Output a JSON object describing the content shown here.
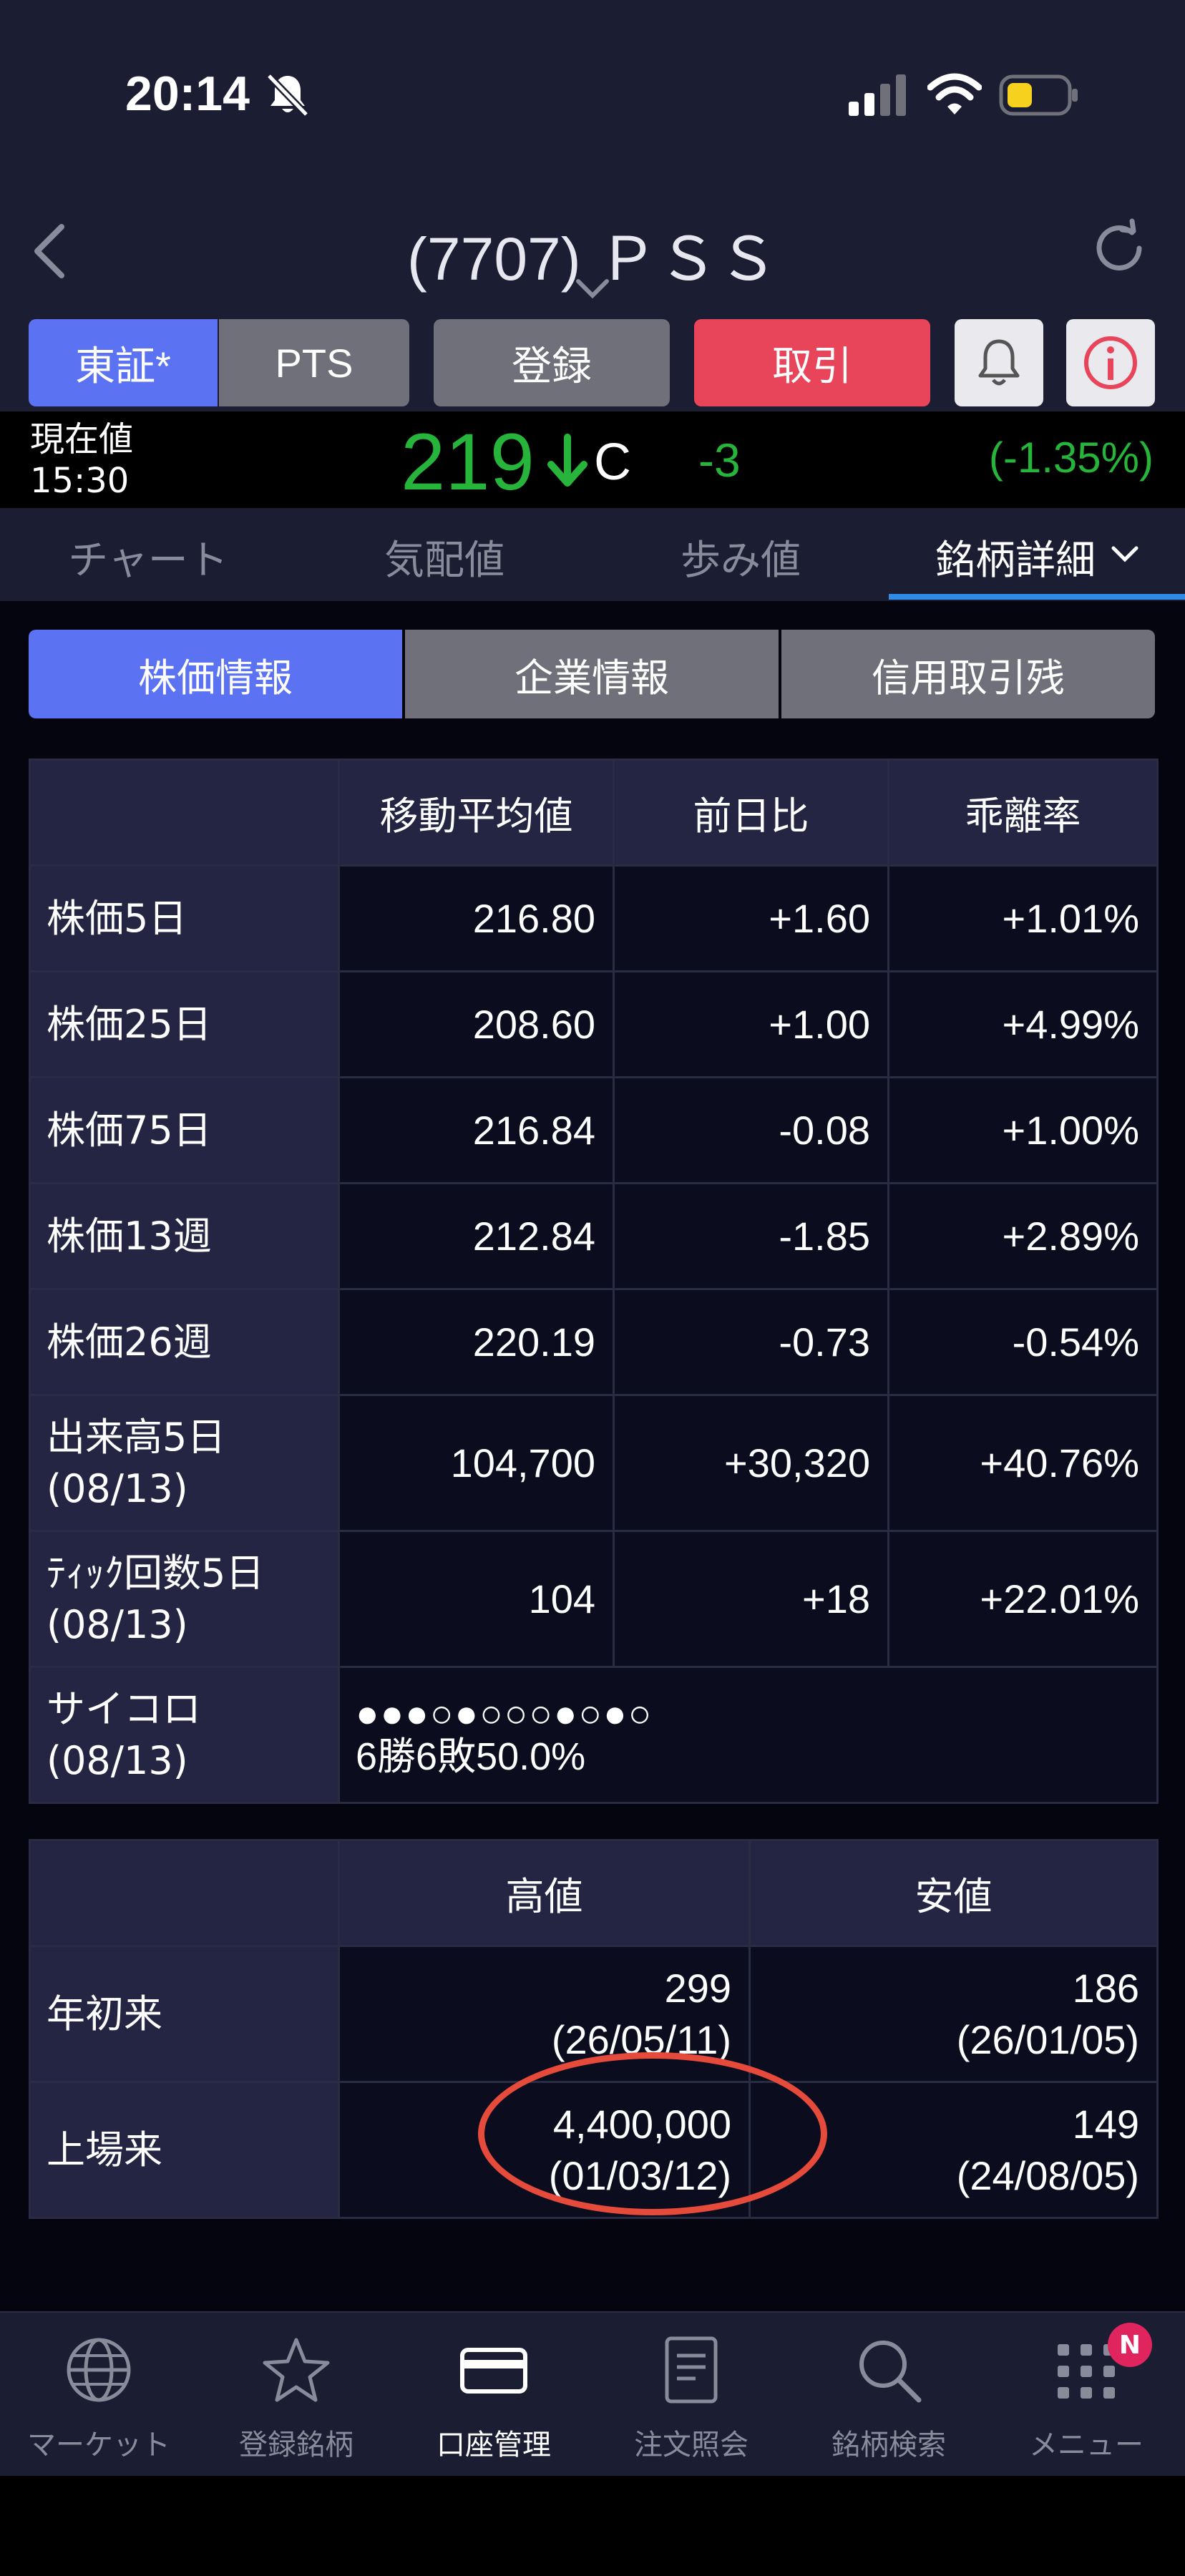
{
  "status_bar": {
    "time": "20:14"
  },
  "header": {
    "title": "(7707) ＰＳＳ"
  },
  "buttons": {
    "tosho": "東証*",
    "pts": "PTS",
    "register": "登録",
    "trade": "取引"
  },
  "price": {
    "label_line1": "現在値",
    "label_line2": "15:30",
    "value": "219",
    "flag": "C",
    "change": "-3",
    "change_pct": "(-1.35%)",
    "color_down": "#26b53a"
  },
  "tabs": [
    "チャート",
    "気配値",
    "歩み値",
    "銘柄詳細"
  ],
  "segments": [
    "株価情報",
    "企業情報",
    "信用取引残"
  ],
  "ma_table": {
    "headers": [
      "",
      "移動平均値",
      "前日比",
      "乖離率"
    ],
    "rows": [
      {
        "label": "株価5日",
        "value": "216.80",
        "change": "+1.60",
        "deviation": "+1.01%"
      },
      {
        "label": "株価25日",
        "value": "208.60",
        "change": "+1.00",
        "deviation": "+4.99%"
      },
      {
        "label": "株価75日",
        "value": "216.84",
        "change": "-0.08",
        "deviation": "+1.00%"
      },
      {
        "label": "株価13週",
        "value": "212.84",
        "change": "-1.85",
        "deviation": "+2.89%"
      },
      {
        "label": "株価26週",
        "value": "220.19",
        "change": "-0.73",
        "deviation": "-0.54%"
      },
      {
        "label": "出来高5日",
        "label2": "(08/13)",
        "value": "104,700",
        "change": "+30,320",
        "deviation": "+40.76%"
      },
      {
        "label": "ﾃｨｯｸ回数5日",
        "label2": "(08/13)",
        "value": "104",
        "change": "+18",
        "deviation": "+22.01%"
      }
    ],
    "saikoro": {
      "label": "サイコロ",
      "label2": "(08/13)",
      "dots": "●●●○●○○○●○●○",
      "text": "6勝6敗50.0%"
    }
  },
  "high_low_table": {
    "headers": [
      "",
      "高値",
      "安値"
    ],
    "rows": [
      {
        "label": "年初来",
        "high": "299",
        "high_date": "(26/05/11)",
        "low": "186",
        "low_date": "(26/01/05)"
      },
      {
        "label": "上場来",
        "high": "4,400,000",
        "high_date": "(01/03/12)",
        "low": "149",
        "low_date": "(24/08/05)"
      }
    ]
  },
  "bottom_nav": {
    "items": [
      {
        "label": "マーケット",
        "icon": "globe-icon"
      },
      {
        "label": "登録銘柄",
        "icon": "star-icon"
      },
      {
        "label": "口座管理",
        "icon": "card-icon"
      },
      {
        "label": "注文照会",
        "icon": "document-icon"
      },
      {
        "label": "銘柄検索",
        "icon": "search-icon"
      },
      {
        "label": "メニュー",
        "icon": "grid-icon"
      }
    ],
    "badge": "N"
  }
}
